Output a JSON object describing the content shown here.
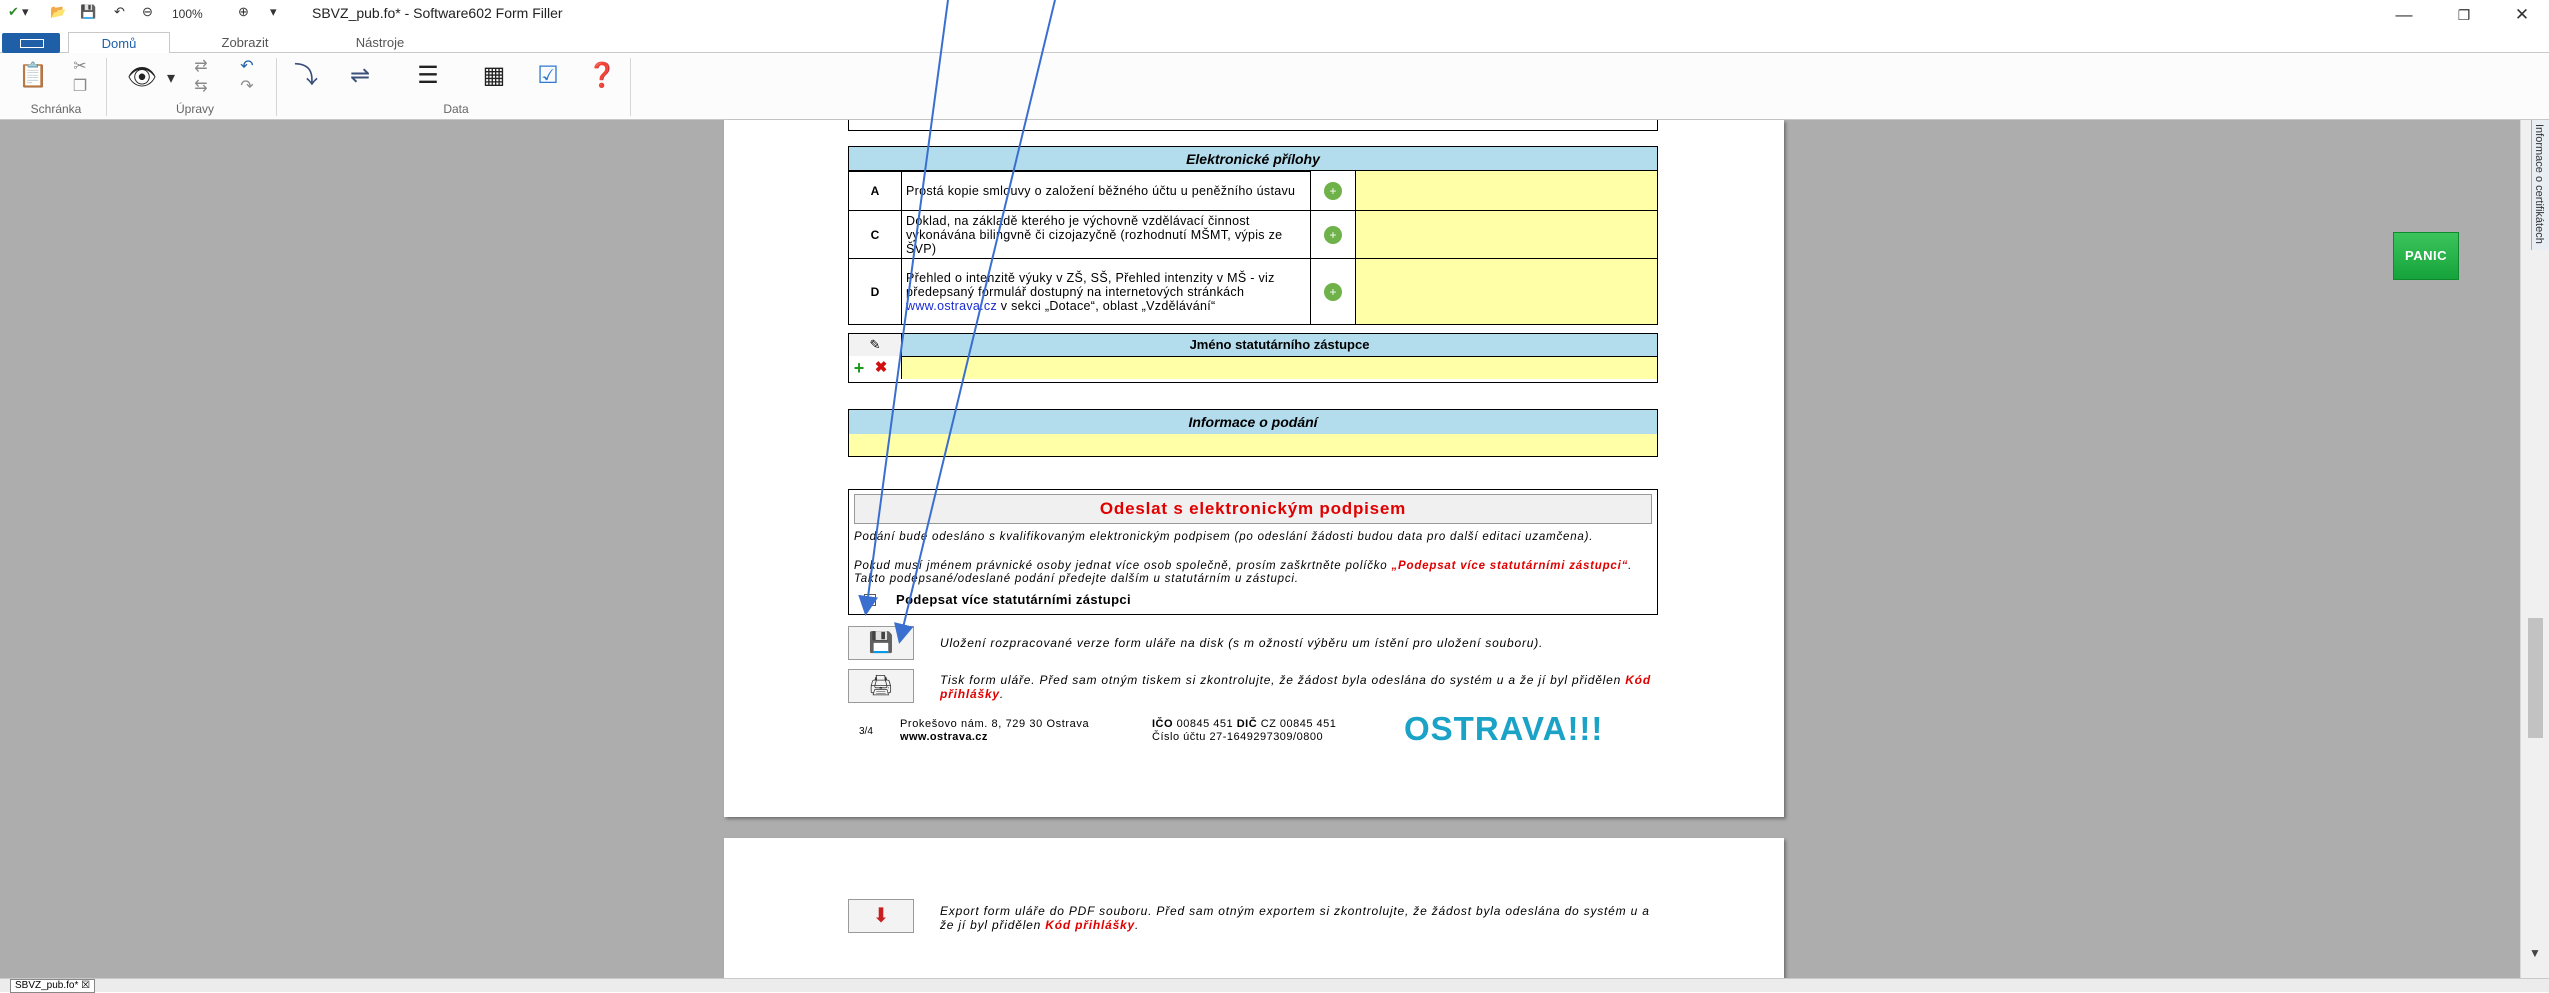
{
  "window": {
    "zoom": "100%",
    "title": "SBVZ_pub.fo* - Software602 Form Filler",
    "minimize_glyph": "—",
    "restore_glyph": "❐",
    "close_glyph": "✕"
  },
  "ribbon": {
    "tabs": [
      "Domů",
      "Zobrazit",
      "Nástroje"
    ],
    "active_tab": "Domů",
    "groups": {
      "clipboard": "Schránka",
      "edits": "Úpravy",
      "data": "Data"
    }
  },
  "side_panel": {
    "label": "Informace o certifikátech"
  },
  "panic_button": "PANIC",
  "form": {
    "attachments_header": "Elektronické přílohy",
    "attachments": [
      {
        "letter": "A",
        "text": "Prostá kopie smlouvy o založení běžného účtu u peněžního ústavu"
      },
      {
        "letter": "C",
        "text": "Doklad, na základě kterého je výchovně vzdělávací činnost vykonávána bilingvně či cizojazyčně (rozhodnutí MŠMT, výpis ze ŠVP)"
      },
      {
        "letter": "D",
        "text_before_link": "Přehled o intenzitě výuky v ZŠ, SŠ, Přehled intenzity v MŠ - viz předepsaný formulář dostupný na internetových stránkách ",
        "link": "www.ostrava.cz",
        "text_after_link": " v sekci „Dotace“, oblast „Vzdělávání“"
      }
    ],
    "statutory_header": "Jméno statutárního zástupce",
    "submission_header": "Informace o podání",
    "sign_header": "Odeslat s elektronickým podpisem",
    "sign_text1": "Podání bude odesláno s kvalifikovaným elektronickým podpisem (po odeslání žádosti budou data pro další editaci uzamčena).",
    "sign_text2_a": "Pokud musí jménem právnické osoby jednat více osob společně, prosím zaškrtněte políčko ",
    "sign_text2_red": "„Podepsat více statutárními zástupci“",
    "sign_text2_b": ". Takto podepsané/odeslané podání předejte dalším u statutárním u zástupci.",
    "sign_checkbox_label": "Podepsat více statutárními zástupci",
    "save_note": "Uložení rozpracované verze form uláře na disk (s m ožností výběru um ístění pro uložení souboru).",
    "print_note_a": "Tisk form uláře. Před sam otným tiskem si zkontrolujte, že žádost byla odeslána do systém u a že jí byl přidělen ",
    "print_note_red": "Kód přihlášky",
    "print_note_end": ".",
    "export_note_a": "Export form uláře do PDF souboru. Před sam otným exportem si zkontrolujte, že žádost byla odeslána do systém u a že jí byl přidělen ",
    "export_note_red": "Kód přihlášky",
    "export_note_end": "."
  },
  "footer": {
    "page_num": "3/4",
    "address": "Prokešovo nám. 8, 729 30 Ostrava",
    "web": "www.ostrava.cz",
    "ico_label": "IČO",
    "ico": " 00845 451",
    "dic_label": "DIČ",
    "dic": " CZ 00845 451",
    "account": "Číslo účtu 27-1649297309/0800",
    "logo": "OSTRAVA!!!"
  },
  "status_bar": {
    "doc_tab": "SBVZ_pub.fo*"
  },
  "colors": {
    "accent": "#1e5fa8",
    "header_blue": "#b3dcec",
    "field_yellow": "#ffffa8",
    "logo": "#1aa3c7",
    "arrow": "#3a6fd0"
  }
}
